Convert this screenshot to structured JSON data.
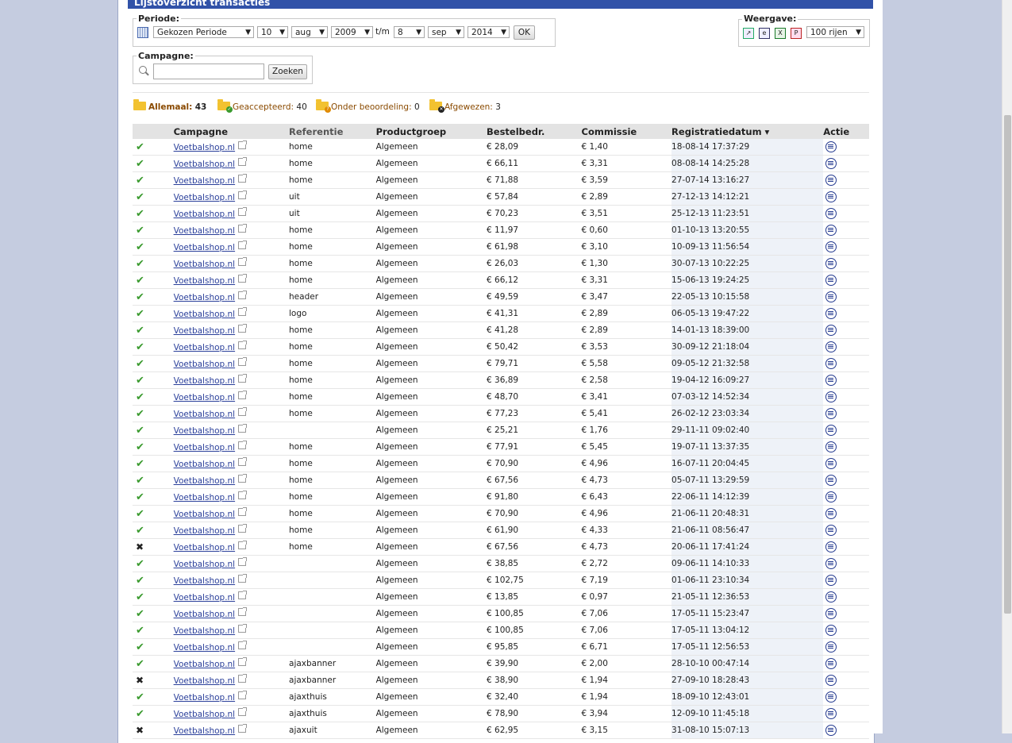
{
  "panel": {
    "title": "Lijstoverzicht transacties"
  },
  "periode": {
    "legend": "Periode:",
    "type": "Gekozen Periode",
    "from_day": "10",
    "from_month": "aug",
    "from_year": "2009",
    "tm": "t/m",
    "to_day": "8",
    "to_month": "sep",
    "to_year": "2014",
    "ok": "OK"
  },
  "weergave": {
    "legend": "Weergave:",
    "rows": "100 rijen"
  },
  "campagne": {
    "legend": "Campagne:",
    "value": "",
    "search": "Zoeken"
  },
  "filters": {
    "all_label": "Allemaal:",
    "all_count": "43",
    "accepted_label": "Geaccepteerd:",
    "accepted_count": "40",
    "review_label": "Onder beoordeling:",
    "review_count": "0",
    "rejected_label": "Afgewezen:",
    "rejected_count": "3"
  },
  "table": {
    "headers": {
      "campagne": "Campagne",
      "referentie": "Referentie",
      "productgroep": "Productgroep",
      "bestel": "Bestelbedr.",
      "commissie": "Commissie",
      "registratie": "Registratiedatum ▾",
      "actie": "Actie"
    },
    "rows": [
      {
        "status": "ok",
        "campagne": "Voetbalshop.nl",
        "ref": "home",
        "prod": "Algemeen",
        "bestel": "€ 28,09",
        "comm": "€ 1,40",
        "date": "18-08-14 17:37:29"
      },
      {
        "status": "ok",
        "campagne": "Voetbalshop.nl",
        "ref": "home",
        "prod": "Algemeen",
        "bestel": "€ 66,11",
        "comm": "€ 3,31",
        "date": "08-08-14 14:25:28"
      },
      {
        "status": "ok",
        "campagne": "Voetbalshop.nl",
        "ref": "home",
        "prod": "Algemeen",
        "bestel": "€ 71,88",
        "comm": "€ 3,59",
        "date": "27-07-14 13:16:27"
      },
      {
        "status": "ok",
        "campagne": "Voetbalshop.nl",
        "ref": "uit",
        "prod": "Algemeen",
        "bestel": "€ 57,84",
        "comm": "€ 2,89",
        "date": "27-12-13 14:12:21"
      },
      {
        "status": "ok",
        "campagne": "Voetbalshop.nl",
        "ref": "uit",
        "prod": "Algemeen",
        "bestel": "€ 70,23",
        "comm": "€ 3,51",
        "date": "25-12-13 11:23:51"
      },
      {
        "status": "ok",
        "campagne": "Voetbalshop.nl",
        "ref": "home",
        "prod": "Algemeen",
        "bestel": "€ 11,97",
        "comm": "€ 0,60",
        "date": "01-10-13 13:20:55"
      },
      {
        "status": "ok",
        "campagne": "Voetbalshop.nl",
        "ref": "home",
        "prod": "Algemeen",
        "bestel": "€ 61,98",
        "comm": "€ 3,10",
        "date": "10-09-13 11:56:54"
      },
      {
        "status": "ok",
        "campagne": "Voetbalshop.nl",
        "ref": "home",
        "prod": "Algemeen",
        "bestel": "€ 26,03",
        "comm": "€ 1,30",
        "date": "30-07-13 10:22:25"
      },
      {
        "status": "ok",
        "campagne": "Voetbalshop.nl",
        "ref": "home",
        "prod": "Algemeen",
        "bestel": "€ 66,12",
        "comm": "€ 3,31",
        "date": "15-06-13 19:24:25"
      },
      {
        "status": "ok",
        "campagne": "Voetbalshop.nl",
        "ref": "header",
        "prod": "Algemeen",
        "bestel": "€ 49,59",
        "comm": "€ 3,47",
        "date": "22-05-13 10:15:58"
      },
      {
        "status": "ok",
        "campagne": "Voetbalshop.nl",
        "ref": "logo",
        "prod": "Algemeen",
        "bestel": "€ 41,31",
        "comm": "€ 2,89",
        "date": "06-05-13 19:47:22"
      },
      {
        "status": "ok",
        "campagne": "Voetbalshop.nl",
        "ref": "home",
        "prod": "Algemeen",
        "bestel": "€ 41,28",
        "comm": "€ 2,89",
        "date": "14-01-13 18:39:00"
      },
      {
        "status": "ok",
        "campagne": "Voetbalshop.nl",
        "ref": "home",
        "prod": "Algemeen",
        "bestel": "€ 50,42",
        "comm": "€ 3,53",
        "date": "30-09-12 21:18:04"
      },
      {
        "status": "ok",
        "campagne": "Voetbalshop.nl",
        "ref": "home",
        "prod": "Algemeen",
        "bestel": "€ 79,71",
        "comm": "€ 5,58",
        "date": "09-05-12 21:32:58"
      },
      {
        "status": "ok",
        "campagne": "Voetbalshop.nl",
        "ref": "home",
        "prod": "Algemeen",
        "bestel": "€ 36,89",
        "comm": "€ 2,58",
        "date": "19-04-12 16:09:27"
      },
      {
        "status": "ok",
        "campagne": "Voetbalshop.nl",
        "ref": "home",
        "prod": "Algemeen",
        "bestel": "€ 48,70",
        "comm": "€ 3,41",
        "date": "07-03-12 14:52:34"
      },
      {
        "status": "ok",
        "campagne": "Voetbalshop.nl",
        "ref": "home",
        "prod": "Algemeen",
        "bestel": "€ 77,23",
        "comm": "€ 5,41",
        "date": "26-02-12 23:03:34"
      },
      {
        "status": "ok",
        "campagne": "Voetbalshop.nl",
        "ref": "",
        "prod": "Algemeen",
        "bestel": "€ 25,21",
        "comm": "€ 1,76",
        "date": "29-11-11 09:02:40"
      },
      {
        "status": "ok",
        "campagne": "Voetbalshop.nl",
        "ref": "home",
        "prod": "Algemeen",
        "bestel": "€ 77,91",
        "comm": "€ 5,45",
        "date": "19-07-11 13:37:35"
      },
      {
        "status": "ok",
        "campagne": "Voetbalshop.nl",
        "ref": "home",
        "prod": "Algemeen",
        "bestel": "€ 70,90",
        "comm": "€ 4,96",
        "date": "16-07-11 20:04:45"
      },
      {
        "status": "ok",
        "campagne": "Voetbalshop.nl",
        "ref": "home",
        "prod": "Algemeen",
        "bestel": "€ 67,56",
        "comm": "€ 4,73",
        "date": "05-07-11 13:29:59"
      },
      {
        "status": "ok",
        "campagne": "Voetbalshop.nl",
        "ref": "home",
        "prod": "Algemeen",
        "bestel": "€ 91,80",
        "comm": "€ 6,43",
        "date": "22-06-11 14:12:39"
      },
      {
        "status": "ok",
        "campagne": "Voetbalshop.nl",
        "ref": "home",
        "prod": "Algemeen",
        "bestel": "€ 70,90",
        "comm": "€ 4,96",
        "date": "21-06-11 20:48:31"
      },
      {
        "status": "ok",
        "campagne": "Voetbalshop.nl",
        "ref": "home",
        "prod": "Algemeen",
        "bestel": "€ 61,90",
        "comm": "€ 4,33",
        "date": "21-06-11 08:56:47"
      },
      {
        "status": "rejected",
        "campagne": "Voetbalshop.nl",
        "ref": "home",
        "prod": "Algemeen",
        "bestel": "€ 67,56",
        "comm": "€ 4,73",
        "date": "20-06-11 17:41:24"
      },
      {
        "status": "ok",
        "campagne": "Voetbalshop.nl",
        "ref": "",
        "prod": "Algemeen",
        "bestel": "€ 38,85",
        "comm": "€ 2,72",
        "date": "09-06-11 14:10:33"
      },
      {
        "status": "ok",
        "campagne": "Voetbalshop.nl",
        "ref": "",
        "prod": "Algemeen",
        "bestel": "€ 102,75",
        "comm": "€ 7,19",
        "date": "01-06-11 23:10:34"
      },
      {
        "status": "ok",
        "campagne": "Voetbalshop.nl",
        "ref": "",
        "prod": "Algemeen",
        "bestel": "€ 13,85",
        "comm": "€ 0,97",
        "date": "21-05-11 12:36:53"
      },
      {
        "status": "ok",
        "campagne": "Voetbalshop.nl",
        "ref": "",
        "prod": "Algemeen",
        "bestel": "€ 100,85",
        "comm": "€ 7,06",
        "date": "17-05-11 15:23:47"
      },
      {
        "status": "ok",
        "campagne": "Voetbalshop.nl",
        "ref": "",
        "prod": "Algemeen",
        "bestel": "€ 100,85",
        "comm": "€ 7,06",
        "date": "17-05-11 13:04:12"
      },
      {
        "status": "ok",
        "campagne": "Voetbalshop.nl",
        "ref": "",
        "prod": "Algemeen",
        "bestel": "€ 95,85",
        "comm": "€ 6,71",
        "date": "17-05-11 12:56:53"
      },
      {
        "status": "ok",
        "campagne": "Voetbalshop.nl",
        "ref": "ajaxbanner",
        "prod": "Algemeen",
        "bestel": "€ 39,90",
        "comm": "€ 2,00",
        "date": "28-10-10 00:47:14"
      },
      {
        "status": "rejected",
        "campagne": "Voetbalshop.nl",
        "ref": "ajaxbanner",
        "prod": "Algemeen",
        "bestel": "€ 38,90",
        "comm": "€ 1,94",
        "date": "27-09-10 18:28:43"
      },
      {
        "status": "ok",
        "campagne": "Voetbalshop.nl",
        "ref": "ajaxthuis",
        "prod": "Algemeen",
        "bestel": "€ 32,40",
        "comm": "€ 1,94",
        "date": "18-09-10 12:43:01"
      },
      {
        "status": "ok",
        "campagne": "Voetbalshop.nl",
        "ref": "ajaxthuis",
        "prod": "Algemeen",
        "bestel": "€ 78,90",
        "comm": "€ 3,94",
        "date": "12-09-10 11:45:18"
      },
      {
        "status": "rejected",
        "campagne": "Voetbalshop.nl",
        "ref": "ajaxuit",
        "prod": "Algemeen",
        "bestel": "€ 62,95",
        "comm": "€ 3,15",
        "date": "31-08-10 15:07:13"
      }
    ]
  }
}
